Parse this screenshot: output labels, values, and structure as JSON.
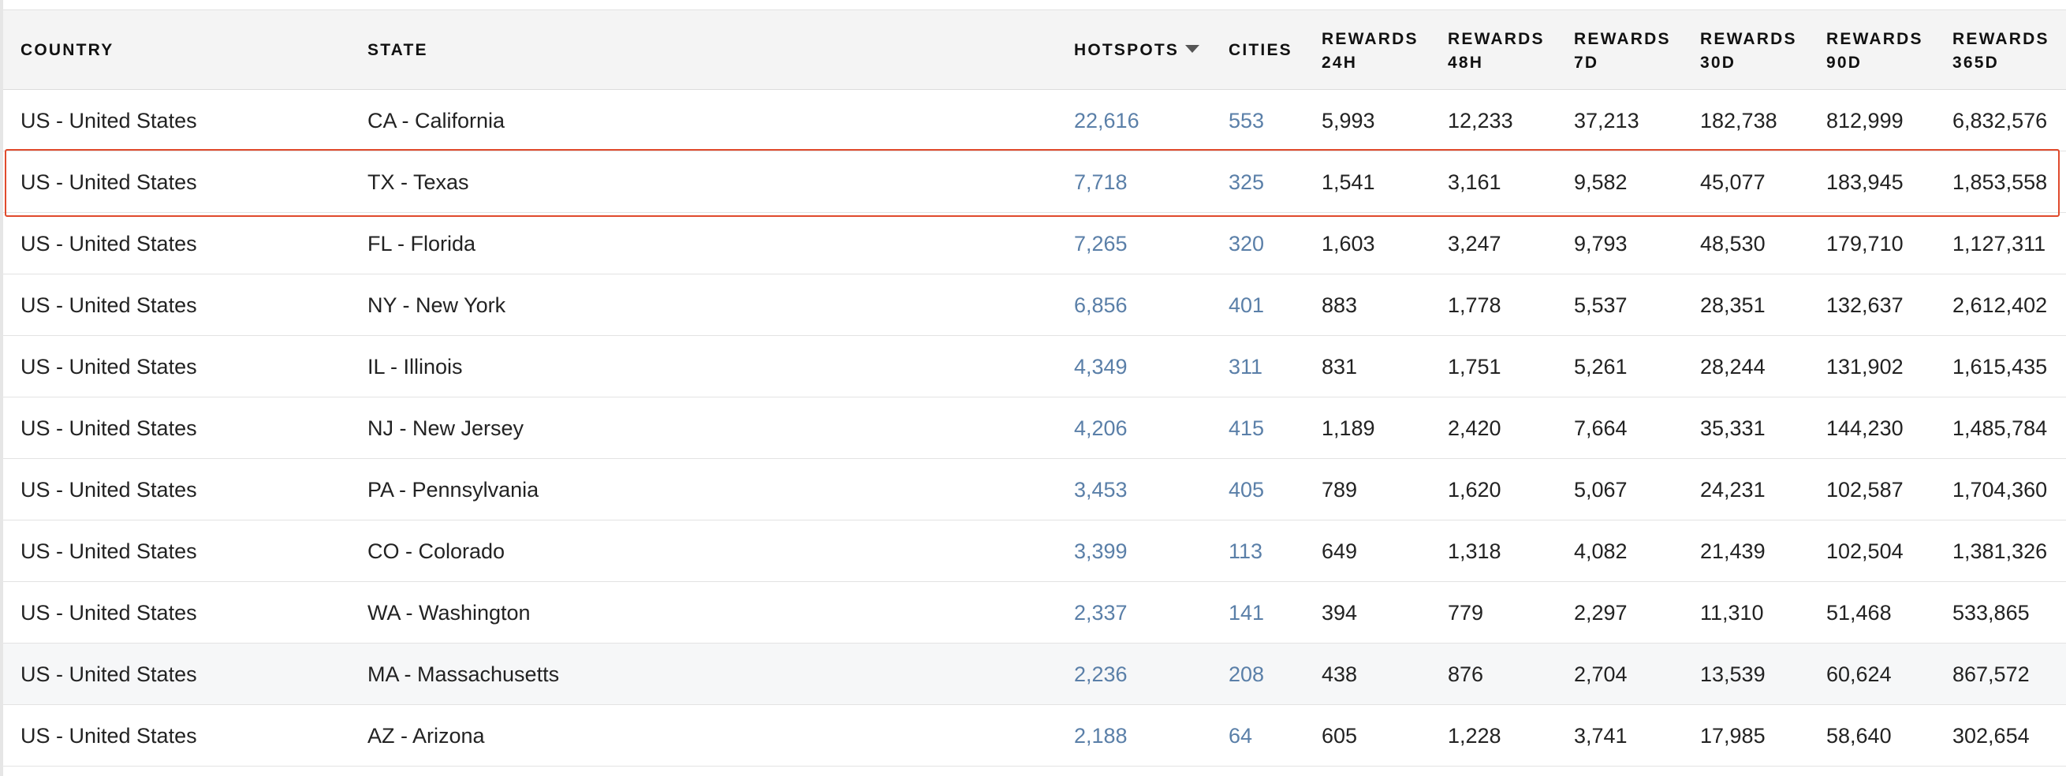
{
  "table": {
    "headers": {
      "country": "COUNTRY",
      "state": "STATE",
      "hotspots": "HOTSPOTS",
      "cities": "CITIES",
      "rewards_24h": [
        "REWARDS",
        "24H"
      ],
      "rewards_48h": [
        "REWARDS",
        "48H"
      ],
      "rewards_7d": [
        "REWARDS",
        "7D"
      ],
      "rewards_30d": [
        "REWARDS",
        "30D"
      ],
      "rewards_90d": [
        "REWARDS",
        "90D"
      ],
      "rewards_365d": [
        "REWARDS",
        "365D"
      ]
    },
    "sort_icon": "caret-down-icon",
    "highlight_color": "#e04a2c",
    "link_color": "#5a7fa8",
    "highlighted_row_state": "TX - Texas",
    "rows": [
      {
        "country": "US - United States",
        "state": "CA - California",
        "hotspots": "22,616",
        "cities": "553",
        "r24h": "5,993",
        "r48h": "12,233",
        "r7d": "37,213",
        "r30d": "182,738",
        "r90d": "812,999",
        "r365d": "6,832,576"
      },
      {
        "country": "US - United States",
        "state": "TX - Texas",
        "hotspots": "7,718",
        "cities": "325",
        "r24h": "1,541",
        "r48h": "3,161",
        "r7d": "9,582",
        "r30d": "45,077",
        "r90d": "183,945",
        "r365d": "1,853,558"
      },
      {
        "country": "US - United States",
        "state": "FL - Florida",
        "hotspots": "7,265",
        "cities": "320",
        "r24h": "1,603",
        "r48h": "3,247",
        "r7d": "9,793",
        "r30d": "48,530",
        "r90d": "179,710",
        "r365d": "1,127,311"
      },
      {
        "country": "US - United States",
        "state": "NY - New York",
        "hotspots": "6,856",
        "cities": "401",
        "r24h": "883",
        "r48h": "1,778",
        "r7d": "5,537",
        "r30d": "28,351",
        "r90d": "132,637",
        "r365d": "2,612,402"
      },
      {
        "country": "US - United States",
        "state": "IL - Illinois",
        "hotspots": "4,349",
        "cities": "311",
        "r24h": "831",
        "r48h": "1,751",
        "r7d": "5,261",
        "r30d": "28,244",
        "r90d": "131,902",
        "r365d": "1,615,435"
      },
      {
        "country": "US - United States",
        "state": "NJ - New Jersey",
        "hotspots": "4,206",
        "cities": "415",
        "r24h": "1,189",
        "r48h": "2,420",
        "r7d": "7,664",
        "r30d": "35,331",
        "r90d": "144,230",
        "r365d": "1,485,784"
      },
      {
        "country": "US - United States",
        "state": "PA - Pennsylvania",
        "hotspots": "3,453",
        "cities": "405",
        "r24h": "789",
        "r48h": "1,620",
        "r7d": "5,067",
        "r30d": "24,231",
        "r90d": "102,587",
        "r365d": "1,704,360"
      },
      {
        "country": "US - United States",
        "state": "CO - Colorado",
        "hotspots": "3,399",
        "cities": "113",
        "r24h": "649",
        "r48h": "1,318",
        "r7d": "4,082",
        "r30d": "21,439",
        "r90d": "102,504",
        "r365d": "1,381,326"
      },
      {
        "country": "US - United States",
        "state": "WA - Washington",
        "hotspots": "2,337",
        "cities": "141",
        "r24h": "394",
        "r48h": "779",
        "r7d": "2,297",
        "r30d": "11,310",
        "r90d": "51,468",
        "r365d": "533,865"
      },
      {
        "country": "US - United States",
        "state": "MA - Massachusetts",
        "hotspots": "2,236",
        "cities": "208",
        "r24h": "438",
        "r48h": "876",
        "r7d": "2,704",
        "r30d": "13,539",
        "r90d": "60,624",
        "r365d": "867,572"
      },
      {
        "country": "US - United States",
        "state": "AZ - Arizona",
        "hotspots": "2,188",
        "cities": "64",
        "r24h": "605",
        "r48h": "1,228",
        "r7d": "3,741",
        "r30d": "17,985",
        "r90d": "58,640",
        "r365d": "302,654"
      }
    ]
  }
}
